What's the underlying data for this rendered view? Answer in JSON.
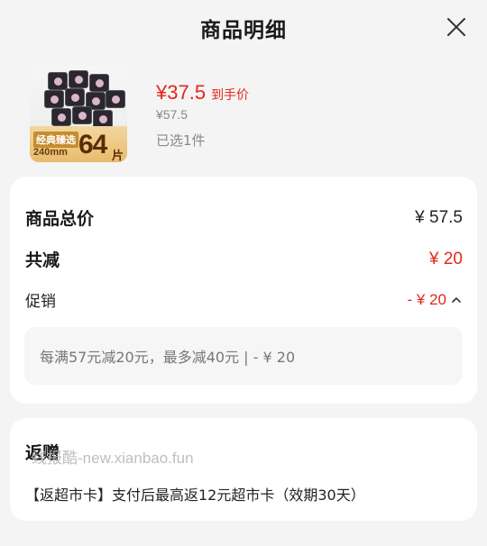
{
  "header": {
    "title": "商品明细"
  },
  "product": {
    "thumb": {
      "line1": "经典臻选",
      "line2": "240mm",
      "count": "64",
      "unit": "片"
    },
    "price": "¥37.5",
    "price_tag": "到手价",
    "original_price": "¥57.5",
    "selected": "已选1件"
  },
  "summary": {
    "total_label": "商品总价",
    "total_value": "¥ 57.5",
    "discount_label": "共减",
    "discount_value": "¥ 20",
    "promo_label": "促销",
    "promo_value": "- ¥ 20",
    "promo_detail": "每满57元减20元，最多减40元 | - ¥ 20"
  },
  "gift": {
    "title": "返赠",
    "watermark": "线报酷-new.xianbao.fun",
    "description": "【返超市卡】支付后最高返12元超市卡（效期30天）"
  },
  "colors": {
    "accent_red": "#e3261b",
    "background": "#f4f4f4",
    "card": "#ffffff"
  },
  "icons": {
    "close": "close-icon",
    "chevron": "chevron-up-icon"
  }
}
